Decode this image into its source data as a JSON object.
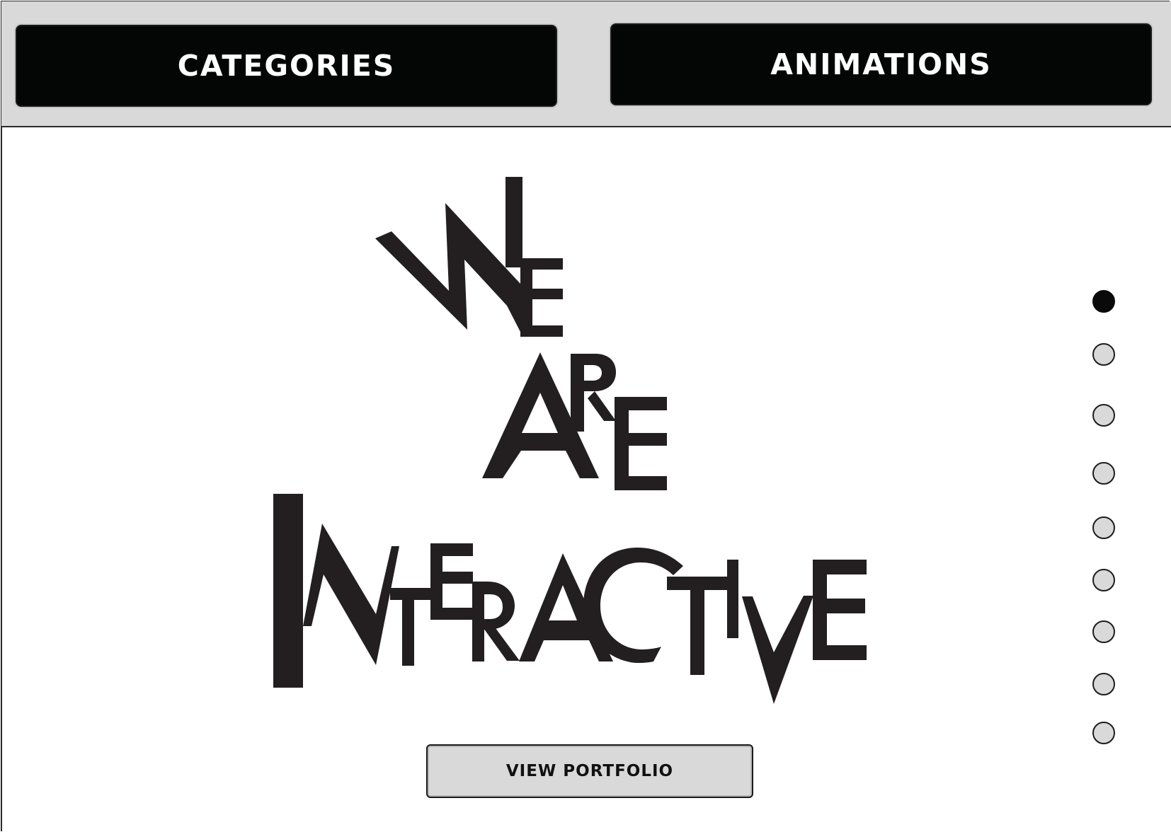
{
  "nav": {
    "categories_label": "CATEGORIES",
    "animations_label": "ANIMATIONS"
  },
  "hero": {
    "line1": "WE",
    "line2": "ARE",
    "line3": "INTERACTIVE"
  },
  "pagination": {
    "total": 9,
    "active_index": 0
  },
  "cta": {
    "label": "VIEW PORTFOLIO"
  },
  "colors": {
    "bar_background": "#d8d9d8",
    "button_black": "#040605",
    "ink": "#231f20",
    "page_background": "#ffffff"
  }
}
